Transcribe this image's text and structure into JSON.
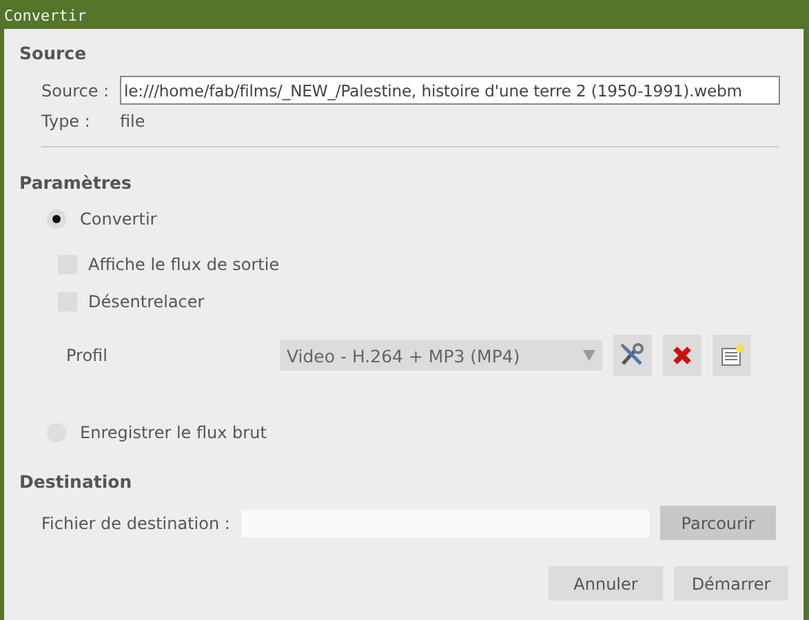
{
  "window": {
    "title": "Convertir"
  },
  "source": {
    "heading": "Source",
    "source_label": "Source :",
    "source_value": "le:///home/fab/films/_NEW_/Palestine, histoire d'une terre 2 (1950-1991).webm",
    "type_label": "Type :",
    "type_value": "file"
  },
  "parameters": {
    "heading": "Paramètres",
    "convert": {
      "label": "Convertir",
      "selected": true
    },
    "options": [
      {
        "label": "Affiche le flux de sortie",
        "checked": false
      },
      {
        "label": "Désentrelacer",
        "checked": false
      }
    ],
    "profile_label": "Profil",
    "profile_value": "Video - H.264 + MP3 (MP4)",
    "raw": {
      "label": "Enregistrer le flux brut",
      "selected": false
    }
  },
  "destination": {
    "heading": "Destination",
    "file_label": "Fichier de destination :",
    "browse_button": "Parcourir"
  },
  "buttons": [
    "Annuler",
    "Démarrer"
  ]
}
